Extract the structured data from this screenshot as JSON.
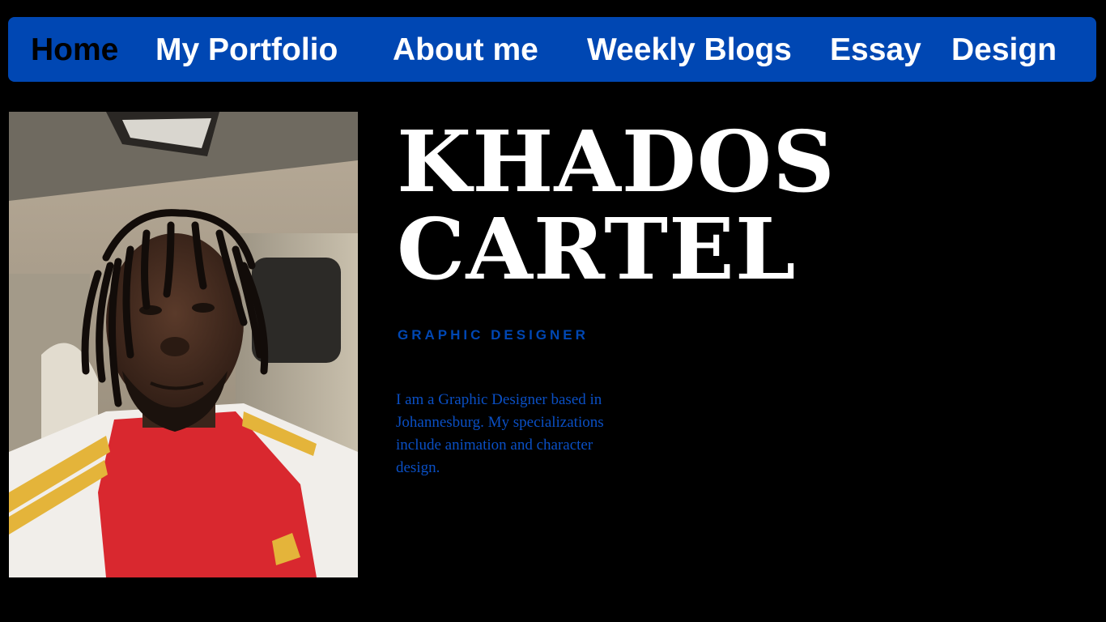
{
  "theme": {
    "background": "#000000",
    "accent": "#0047b3",
    "nav_text": "#ffffff",
    "nav_active_text": "#000000",
    "title_color": "#ffffff",
    "body_text": "#0a4fc4"
  },
  "nav": {
    "items": [
      {
        "label": "Home",
        "active": true
      },
      {
        "label": "My Portfolio",
        "active": false
      },
      {
        "label": "About me",
        "active": false
      },
      {
        "label": "Weekly Blogs",
        "active": false
      },
      {
        "label": "Essay",
        "active": false
      },
      {
        "label": "Design",
        "active": false
      }
    ]
  },
  "hero": {
    "name_line1": "KHADOS",
    "name_line2": "CARTEL",
    "role": "GRAPHIC DESIGNER",
    "bio": "I am a Graphic Designer based in Johannesburg. My specializations include animation and character design."
  }
}
